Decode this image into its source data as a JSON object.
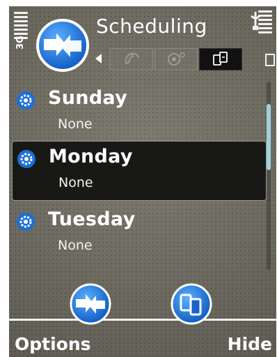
{
  "header": {
    "title": "Scheduling",
    "signal_label": "3G",
    "app_icon": "sync-arrows-icon",
    "tabs": [
      {
        "icon": "phone-icon",
        "active": false
      },
      {
        "icon": "settings-icon",
        "active": false
      },
      {
        "icon": "sync-devices-icon",
        "active": true
      }
    ]
  },
  "list": {
    "items": [
      {
        "day": "Sunday",
        "value": "None",
        "selected": false
      },
      {
        "day": "Monday",
        "value": "None",
        "selected": true
      },
      {
        "day": "Tuesday",
        "value": "None",
        "selected": false
      }
    ]
  },
  "toolbar": {
    "buttons": [
      {
        "icon": "sync-arrows-icon"
      },
      {
        "icon": "devices-icon"
      }
    ]
  },
  "softkeys": {
    "left": "Options",
    "right": "Hide"
  },
  "colors": {
    "background": "#6e6b61",
    "selected_row": "#181816",
    "scroll_thumb": "#9fd0db",
    "icon_blue": "#1c6fd6"
  }
}
